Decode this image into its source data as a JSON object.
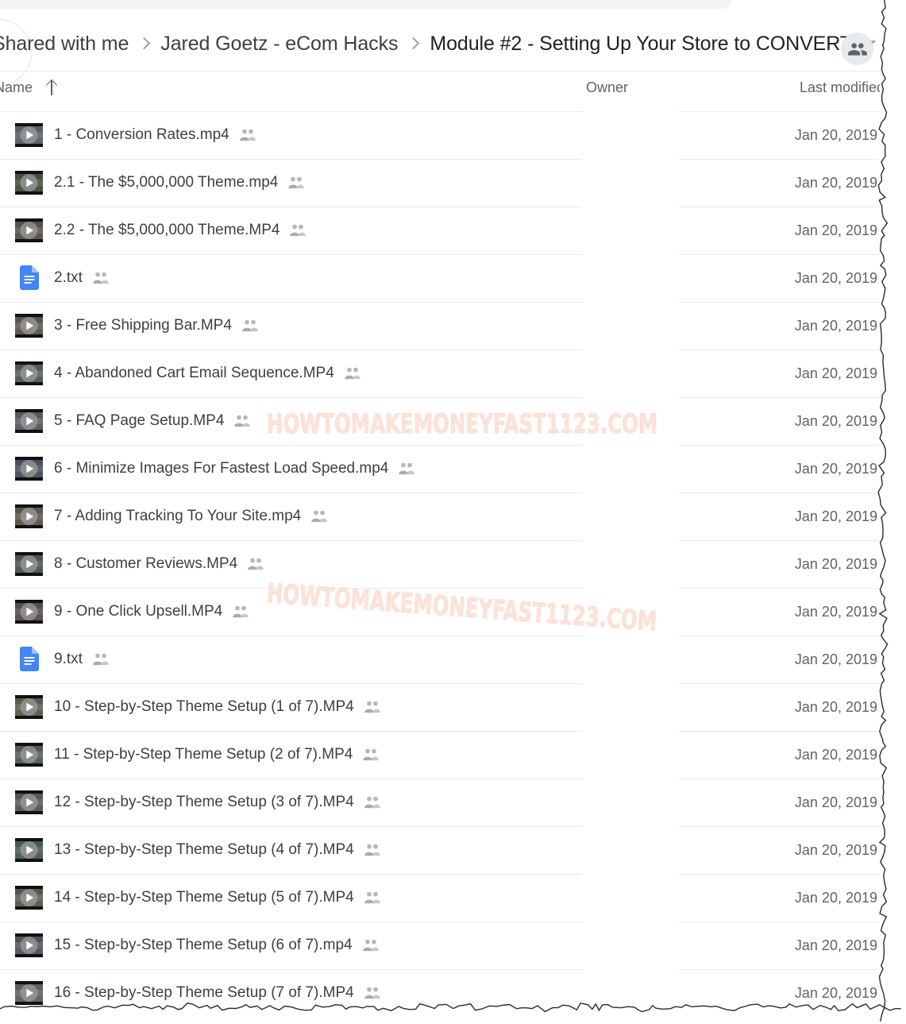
{
  "window": {
    "app": "Google Drive",
    "watermark_text": "HOWTOMAKEMONEYFAST1123.COM",
    "watermark_color": "#fce3da"
  },
  "header": {
    "breadcrumbs": [
      {
        "label": "Shared with me"
      },
      {
        "label": "Jared Goetz - eCom Hacks"
      },
      {
        "label": "Module #2 - Setting Up Your Store to CONVERT"
      }
    ],
    "caret_icon": "chevron-down-icon",
    "share_avatar_icon": "people-shared-icon"
  },
  "columns": {
    "name": "Name",
    "sort_icon": "arrow-up-icon",
    "owner": "Owner",
    "last_modified": "Last modified"
  },
  "colors": {
    "divider": "#e8eaed",
    "text_primary": "#3c4043",
    "text_secondary": "#5f6368",
    "doc_blue": "#4285f4"
  },
  "files": [
    {
      "name": "1 - Conversion Rates.mp4",
      "type": "video",
      "shared": true,
      "owner": "",
      "modified": "Jan 20, 2019"
    },
    {
      "name": "2.1 - The $5,000,000 Theme.mp4",
      "type": "video",
      "shared": true,
      "owner": "",
      "modified": "Jan 20, 2019"
    },
    {
      "name": "2.2 - The $5,000,000 Theme.MP4",
      "type": "video",
      "shared": true,
      "owner": "",
      "modified": "Jan 20, 2019"
    },
    {
      "name": "2.txt",
      "type": "doc",
      "shared": true,
      "owner": "",
      "modified": "Jan 20, 2019"
    },
    {
      "name": "3 - Free Shipping Bar.MP4",
      "type": "video",
      "shared": true,
      "owner": "",
      "modified": "Jan 20, 2019"
    },
    {
      "name": "4 - Abandoned Cart Email Sequence.MP4",
      "type": "video",
      "shared": true,
      "owner": "",
      "modified": "Jan 20, 2019"
    },
    {
      "name": "5 - FAQ Page Setup.MP4",
      "type": "video",
      "shared": true,
      "owner": "",
      "modified": "Jan 20, 2019"
    },
    {
      "name": "6 - Minimize Images For Fastest Load Speed.mp4",
      "type": "video",
      "shared": true,
      "owner": "",
      "modified": "Jan 20, 2019"
    },
    {
      "name": "7 - Adding Tracking To Your Site.mp4",
      "type": "video",
      "shared": true,
      "owner": "",
      "modified": "Jan 20, 2019"
    },
    {
      "name": "8 - Customer Reviews.MP4",
      "type": "video",
      "shared": true,
      "owner": "",
      "modified": "Jan 20, 2019"
    },
    {
      "name": "9 - One Click Upsell.MP4",
      "type": "video",
      "shared": true,
      "owner": "",
      "modified": "Jan 20, 2019"
    },
    {
      "name": "9.txt",
      "type": "doc",
      "shared": true,
      "owner": "",
      "modified": "Jan 20, 2019"
    },
    {
      "name": "10 - Step-by-Step Theme Setup (1 of 7).MP4",
      "type": "video",
      "shared": true,
      "owner": "",
      "modified": "Jan 20, 2019"
    },
    {
      "name": "11 - Step-by-Step Theme Setup (2 of 7).MP4",
      "type": "video",
      "shared": true,
      "owner": "",
      "modified": "Jan 20, 2019"
    },
    {
      "name": "12 - Step-by-Step Theme Setup (3 of 7).MP4",
      "type": "video",
      "shared": true,
      "owner": "",
      "modified": "Jan 20, 2019"
    },
    {
      "name": "13 - Step-by-Step Theme Setup (4 of 7).MP4",
      "type": "video",
      "shared": true,
      "owner": "",
      "modified": "Jan 20, 2019"
    },
    {
      "name": "14 - Step-by-Step Theme Setup (5 of 7).MP4",
      "type": "video",
      "shared": true,
      "owner": "",
      "modified": "Jan 20, 2019"
    },
    {
      "name": "15 - Step-by-Step Theme Setup (6 of 7).mp4",
      "type": "video",
      "shared": true,
      "owner": "",
      "modified": "Jan 20, 2019"
    },
    {
      "name": "16 - Step-by-Step Theme Setup (7 of 7).MP4",
      "type": "video",
      "shared": true,
      "owner": "",
      "modified": "Jan 20, 2019"
    }
  ]
}
